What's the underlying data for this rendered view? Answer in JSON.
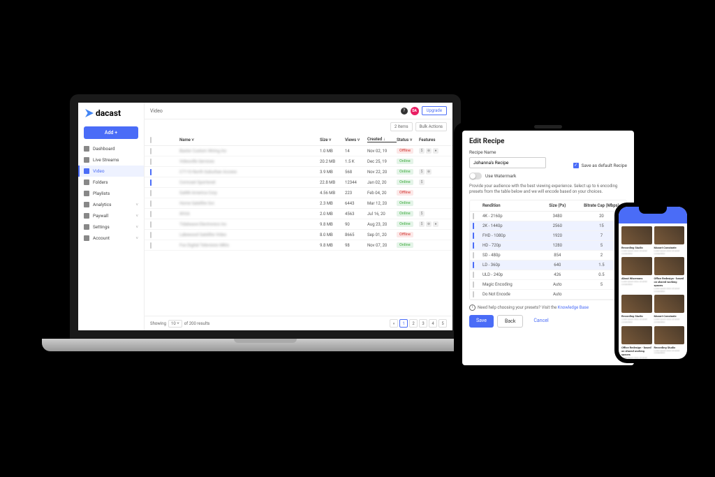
{
  "laptop": {
    "brand": "dacast",
    "addButton": "Add +",
    "nav": [
      {
        "label": "Dashboard",
        "active": false
      },
      {
        "label": "Live Streams",
        "active": false
      },
      {
        "label": "Video",
        "active": true
      },
      {
        "label": "Folders",
        "active": false
      },
      {
        "label": "Playlists",
        "active": false
      },
      {
        "label": "Analytics",
        "active": false,
        "expandable": true
      },
      {
        "label": "Paywall",
        "active": false,
        "expandable": true
      },
      {
        "label": "Settings",
        "active": false,
        "expandable": true
      },
      {
        "label": "Account",
        "active": false,
        "expandable": true
      }
    ],
    "header": {
      "title": "Video",
      "upgrade": "Upgrade",
      "avatarInitials": "DA"
    },
    "filterBar": {
      "itemCount": "2 items",
      "bulkActions": "Bulk Actions"
    },
    "columns": {
      "name": "Name",
      "size": "Size",
      "views": "Views",
      "created": "Created",
      "status": "Status",
      "features": "Features"
    },
    "rows": [
      {
        "checked": false,
        "name": "Baxter Custom Wiring Inc",
        "size": "1.0 MB",
        "views": "14",
        "created": "Nov 02, 19",
        "status": "Offline",
        "features": "$ ⊕ ●"
      },
      {
        "checked": false,
        "name": "Videoville Services",
        "size": "20.2 MB",
        "views": "1.5 K",
        "created": "Dec 25, 19",
        "status": "Online",
        "features": ""
      },
      {
        "checked": true,
        "name": "C7110 North Suburban Access",
        "size": "3.9 MB",
        "views": "568",
        "created": "Nov 22, 20",
        "status": "Online",
        "features": "$ ⊕"
      },
      {
        "checked": true,
        "name": "Comcast Sportsnet",
        "size": "22.8 MB",
        "views": "12344",
        "created": "Jan 02, 20",
        "status": "Online",
        "features": "$"
      },
      {
        "checked": false,
        "name": "GaNN America Corp",
        "size": "4.56 MB",
        "views": "223",
        "created": "Feb 04, 20",
        "status": "Offline",
        "features": ""
      },
      {
        "checked": false,
        "name": "Home Satellite Svc",
        "size": "2.3 MB",
        "views": "6443",
        "created": "Mar 12, 20",
        "status": "Online",
        "features": ""
      },
      {
        "checked": false,
        "name": "WVIA",
        "size": "2.0 MB",
        "views": "4563",
        "created": "Jul 16, 20",
        "status": "Online",
        "features": "$"
      },
      {
        "checked": false,
        "name": "Tidalwave Electronics Inc",
        "size": "9.8 MB",
        "views": "90",
        "created": "Aug 23, 20",
        "status": "Online",
        "features": "$ ⊕ ●"
      },
      {
        "checked": false,
        "name": "Lakewood Satellite Video",
        "size": "8.0 MB",
        "views": "8665",
        "created": "Sep 01, 20",
        "status": "Offline",
        "features": ""
      },
      {
        "checked": false,
        "name": "Fox Digital Television Mkts",
        "size": "9.8 MB",
        "views": "98",
        "created": "Nov 07, 20",
        "status": "Online",
        "features": ""
      }
    ],
    "pagination": {
      "showing": "Showing",
      "perPage": "10",
      "of": "of 200 results",
      "pages": [
        "1",
        "2",
        "3",
        "4",
        "5"
      ]
    }
  },
  "tablet": {
    "title": "Edit Recipe",
    "recipeNameLabel": "Recipe Name",
    "recipeNameValue": "Johanna's Recipe",
    "saveDefaultLabel": "Save as default Recipe",
    "watermarkLabel": "Use Watermark",
    "description": "Provide your audience with the best viewing experience. Select up to 6 encoding presets from the table below and we will encode based on your choices.",
    "columns": {
      "rendition": "Rendition",
      "size": "Size (Px)",
      "bitrate": "Bitrate Cap (Mbps)"
    },
    "renditions": [
      {
        "checked": false,
        "name": "4K - 2160p",
        "size": "3480",
        "bitrate": "20"
      },
      {
        "checked": true,
        "name": "2K - 1440p",
        "size": "2560",
        "bitrate": "15"
      },
      {
        "checked": true,
        "name": "FHD - 1080p",
        "size": "1920",
        "bitrate": "7"
      },
      {
        "checked": true,
        "name": "HD - 720p",
        "size": "1280",
        "bitrate": "5"
      },
      {
        "checked": false,
        "name": "SD - 480p",
        "size": "854",
        "bitrate": "2"
      },
      {
        "checked": true,
        "name": "LD - 360p",
        "size": "640",
        "bitrate": "1.5"
      },
      {
        "checked": false,
        "name": "ULD - 240p",
        "size": "426",
        "bitrate": "0.5"
      },
      {
        "checked": false,
        "name": "Magic Encoding",
        "size": "Auto",
        "bitrate": "5"
      },
      {
        "checked": false,
        "name": "Do Not Encode",
        "size": "Auto",
        "bitrate": ""
      }
    ],
    "helpText": "Need help choosing your presets? Visit the ",
    "helpLink": "Knowledge Base",
    "buttons": {
      "save": "Save",
      "back": "Back",
      "cancel": "Cancel"
    }
  },
  "phone": {
    "cards": [
      {
        "title": "Recording Studio"
      },
      {
        "title": "Mozart Constante"
      },
      {
        "title": "About Wisemans"
      },
      {
        "title": "Office Redesign - based on shared working spaces"
      },
      {
        "title": "Recording Studio"
      },
      {
        "title": "Mozart Constante"
      },
      {
        "title": "Office Redesign - based on shared working spaces"
      },
      {
        "title": "Recording Studio"
      }
    ]
  }
}
